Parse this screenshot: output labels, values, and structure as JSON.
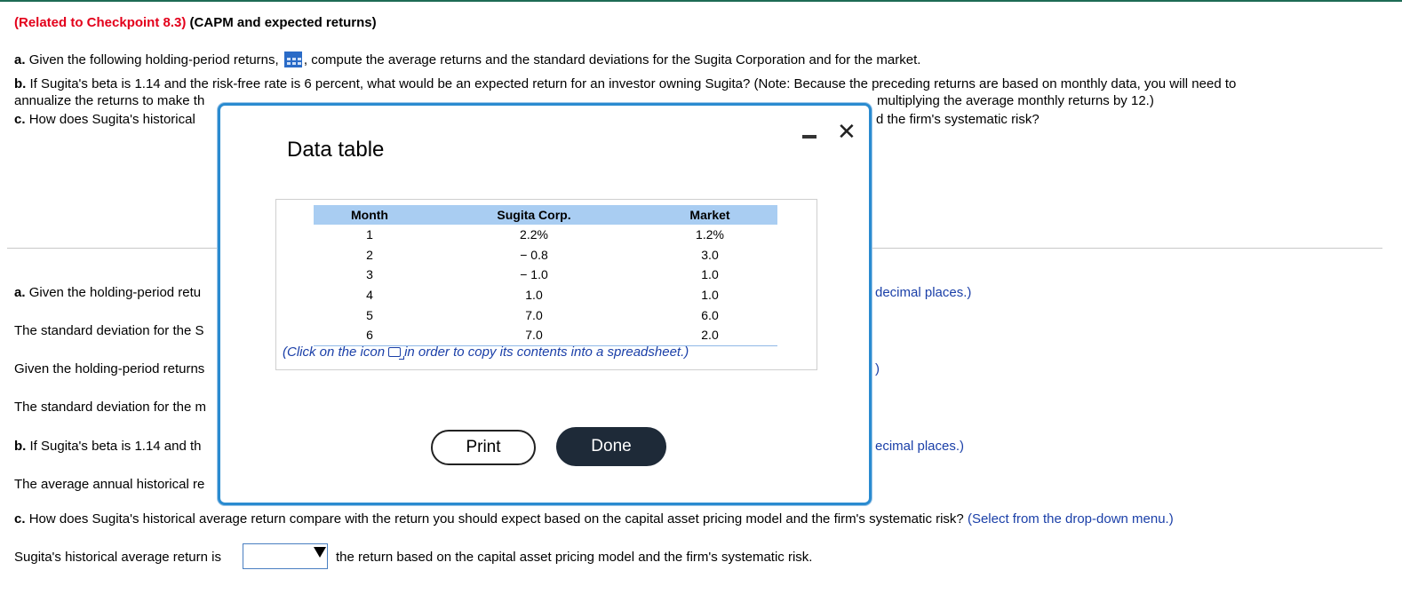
{
  "header": {
    "related": "(Related to Checkpoint 8.3)",
    "title": "(CAPM and expected returns)"
  },
  "questions": {
    "a_label": "a.",
    "a_text_1": "Given the following holding-period returns,",
    "a_text_2": ", compute the average returns and the standard deviations for the Sugita Corporation and for the market.",
    "b_label": "b.",
    "b_text": "If Sugita's beta is 1.14 and the risk-free rate is 6 percent, what would be an expected return for an investor owning Sugita? (Note: Because the preceding returns are based on monthly data, you will need to",
    "b_text_2a": "annualize the returns to make th",
    "b_text_2b": "multiplying the average monthly returns by 12.)",
    "c_label": "c.",
    "c_text_a": "How does Sugita's historical",
    "c_text_b": "d the firm's systematic risk?"
  },
  "answers": {
    "a1_label": "a.",
    "a1_text": "Given the holding-period retu",
    "a1_right": "decimal places.)",
    "sd_sugita": "The standard deviation for the S",
    "given_market": "Given the holding-period returns",
    "given_market_right": ")",
    "sd_market": "The standard deviation for the m",
    "b1_label": "b.",
    "b1_text": "If Sugita's beta is 1.14 and th",
    "b1_right": "ecimal places.)",
    "avg_annual": "The average annual historical re",
    "c1_label": "c.",
    "c1_text": "How does Sugita's historical average return compare with the return you should expect based on the capital asset pricing model and the firm's systematic risk?",
    "c1_hint": "(Select from the drop-down menu.)",
    "sentence_start": "Sugita's historical average return is",
    "sentence_end": "the return based on the capital asset pricing model and the firm's systematic risk."
  },
  "modal": {
    "title": "Data table",
    "columns": [
      "Month",
      "Sugita Corp.",
      "Market"
    ],
    "rows": [
      [
        "1",
        "2.2%",
        "1.2%"
      ],
      [
        "2",
        "− 0.8",
        "3.0"
      ],
      [
        "3",
        "− 1.0",
        "1.0"
      ],
      [
        "4",
        "1.0",
        "1.0"
      ],
      [
        "5",
        "7.0",
        "6.0"
      ],
      [
        "6",
        "7.0",
        "2.0"
      ]
    ],
    "note_before": "(Click on the icon",
    "note_after": "in order to copy its contents into a spreadsheet.)",
    "print_label": "Print",
    "done_label": "Done",
    "close_glyph": "✕"
  },
  "icons": [
    "grid-table-icon",
    "minimize-icon",
    "close-icon",
    "copy-icon",
    "dropdown-arrow-icon"
  ],
  "colors": {
    "related": "#e3001b",
    "hint": "#1a3fa8",
    "modal_border": "#2a8bd0",
    "done_bg": "#1e2a38",
    "table_header": "#a9cdf2"
  }
}
